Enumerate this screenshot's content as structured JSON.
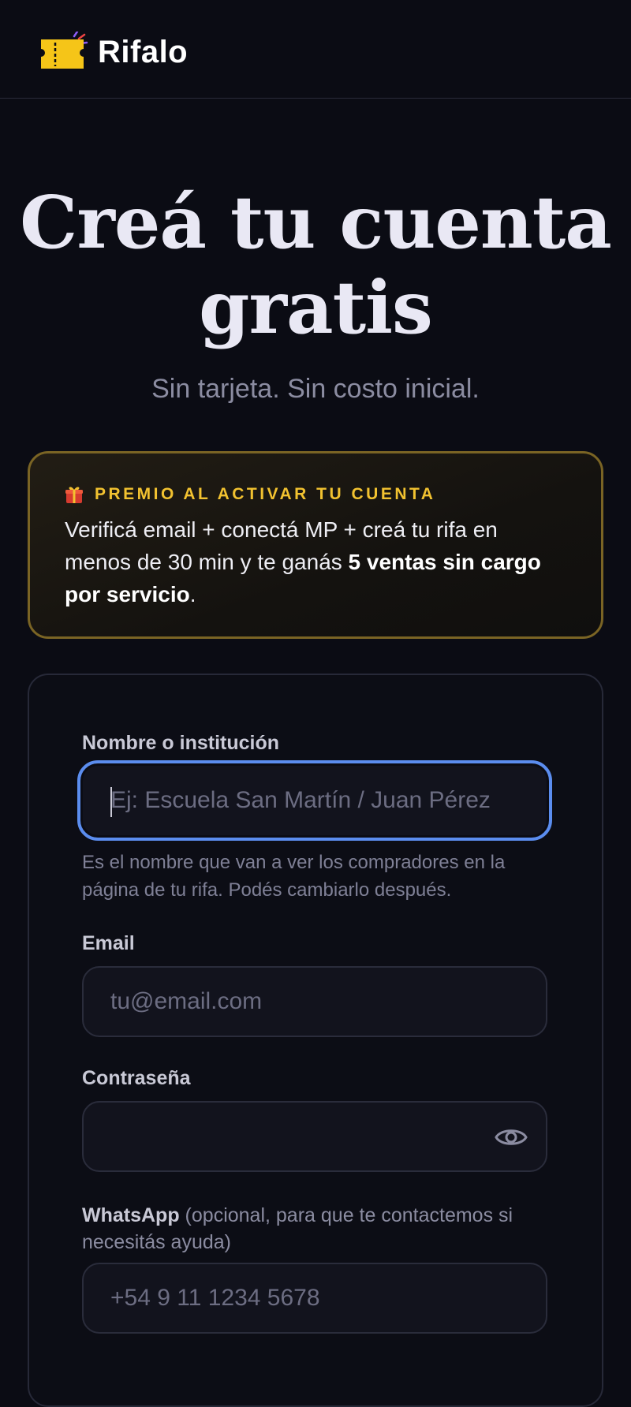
{
  "header": {
    "brand": "Rifalo"
  },
  "hero": {
    "title_line1": "Creá tu cuenta",
    "title_line2": "gratis",
    "subtitle": "Sin tarjeta. Sin costo inicial."
  },
  "promo": {
    "tag": "PREMIO AL ACTIVAR TU CUENTA",
    "text_before": "Verificá email + conectá MP + creá tu rifa en menos de 30 min y te ganás ",
    "text_bold": "5 ventas sin cargo por servicio",
    "text_after": "."
  },
  "form": {
    "name": {
      "label": "Nombre o institución",
      "placeholder": "Ej: Escuela San Martín / Juan Pérez",
      "helper": "Es el nombre que van a ver los compradores en la página de tu rifa. Podés cambiarlo después."
    },
    "email": {
      "label": "Email",
      "placeholder": "tu@email.com"
    },
    "password": {
      "label": "Contraseña",
      "placeholder": ""
    },
    "whatsapp": {
      "label": "WhatsApp",
      "label_optional": " (opcional, para que te contactemos si necesitás ayuda)",
      "placeholder": "+54 9 11 1234 5678"
    }
  },
  "colors": {
    "background": "#0b0c14",
    "accent_gold": "#f2c230",
    "focus_blue": "#5b8def"
  },
  "icons": {
    "logo": "ticket-icon",
    "promo": "gift-icon",
    "password_toggle": "eye-icon"
  }
}
